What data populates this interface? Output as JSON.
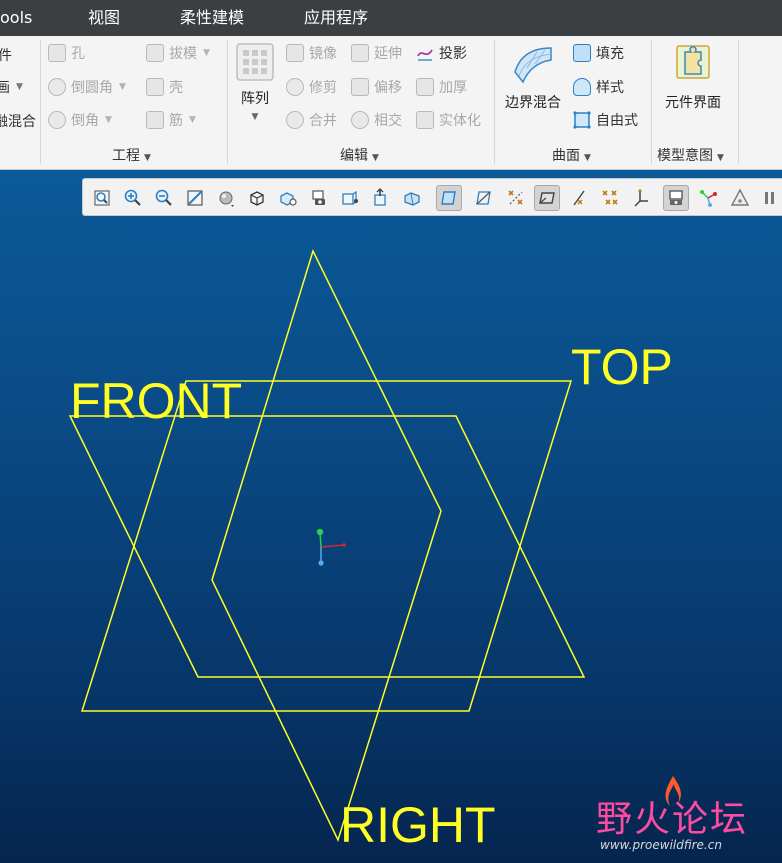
{
  "menubar": {
    "items": [
      "ools",
      "视图",
      "柔性建模",
      "应用程序"
    ]
  },
  "ribbon": {
    "left_clip": {
      "row1": "件",
      "row2": "画",
      "row3": "融混合"
    },
    "engineering": {
      "items": [
        "孔",
        "拔模",
        "倒圆角",
        "壳",
        "倒角",
        "筋"
      ],
      "group_label": "工程"
    },
    "editing": {
      "pattern_label": "阵列",
      "items": [
        "镜像",
        "延伸",
        "投影",
        "修剪",
        "偏移",
        "加厚",
        "合并",
        "相交",
        "实体化"
      ],
      "group_label": "编辑"
    },
    "surfaces": {
      "boundary_blend_label": "边界混合",
      "items": [
        "填充",
        "样式",
        "自由式"
      ],
      "group_label": "曲面"
    },
    "model_intent": {
      "component_interface_label": "元件界面",
      "group_label": "模型意图"
    }
  },
  "canvas": {
    "plane_labels": {
      "front": "FRONT",
      "top": "TOP",
      "right": "RIGHT"
    },
    "colors": {
      "datum_plane": "#ffff24",
      "background_top": "#0b5a9a",
      "background_bottom": "#05254e"
    }
  },
  "watermark": {
    "title": "野火论坛",
    "url": "www.proewildfire.cn"
  }
}
